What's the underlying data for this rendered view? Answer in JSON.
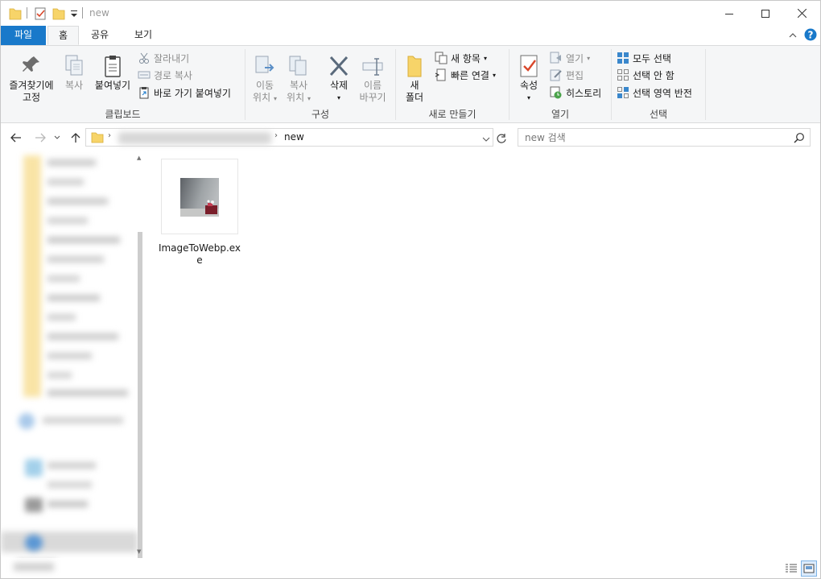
{
  "window": {
    "title": "new"
  },
  "tabs": {
    "file": "파일",
    "home": "홈",
    "share": "공유",
    "view": "보기"
  },
  "ribbon": {
    "clipboard": {
      "label": "클립보드",
      "pin_line1": "즐겨찾기에",
      "pin_line2": "고정",
      "copy": "복사",
      "paste": "붙여넣기",
      "cut": "잘라내기",
      "copy_path": "경로 복사",
      "paste_shortcut": "바로 가기 붙여넣기"
    },
    "organize": {
      "label": "구성",
      "move_line1": "이동",
      "move_line2": "위치",
      "copyto_line1": "복사",
      "copyto_line2": "위치",
      "delete": "삭제",
      "rename_line1": "이름",
      "rename_line2": "바꾸기"
    },
    "new": {
      "label": "새로 만들기",
      "folder_line1": "새",
      "folder_line2": "폴더",
      "new_item": "새 항목",
      "easy_access": "빠른 연결"
    },
    "open": {
      "label": "열기",
      "properties": "속성",
      "open": "열기",
      "edit": "편집",
      "history": "히스토리"
    },
    "select": {
      "label": "선택",
      "select_all": "모두 선택",
      "select_none": "선택 안 함",
      "invert": "선택 영역 반전"
    }
  },
  "address": {
    "current": "new"
  },
  "search": {
    "placeholder": "new 검색"
  },
  "files": [
    {
      "name": "ImageToWebp.exe"
    }
  ],
  "colors": {
    "accent": "#1979ca",
    "folder": "#f7d469",
    "help": "#1979ca"
  }
}
